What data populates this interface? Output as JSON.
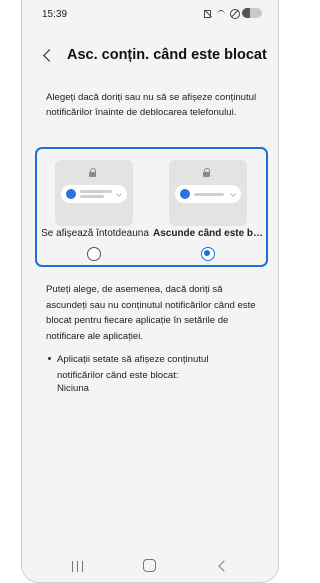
{
  "status_bar": {
    "time": "15:39",
    "icons": [
      "mute-icon",
      "wifi-off-icon",
      "block-icon",
      "battery-icon"
    ]
  },
  "header": {
    "back_icon": "chevron-left-icon",
    "title": "Asc. conțin. când este blocat"
  },
  "intro": "Alegeți dacă doriți sau nu să se afișeze conținutul notificărilor înainte de deblocarea telefonului.",
  "options": [
    {
      "label": "Se afișează întotdeauna",
      "selected": false
    },
    {
      "label": "Ascunde când este blocat",
      "selected": true
    }
  ],
  "info": "Puteți alege, de asemenea, dacă doriți să ascundeți sau nu conținutul notificărilor când este blocat pentru fiecare aplicație în setările de notificare ale aplicației.",
  "bullet": {
    "text": "Aplicații setate să afișeze conținutul notificărilor când este blocat:",
    "value": "Niciuna"
  },
  "nav_bar": {
    "icons": [
      "recents-icon",
      "home-icon",
      "back-icon"
    ]
  },
  "colors": {
    "accent": "#1f6fd6",
    "background": "#f4f4f4",
    "notification_dot": "#2f6fe0"
  }
}
